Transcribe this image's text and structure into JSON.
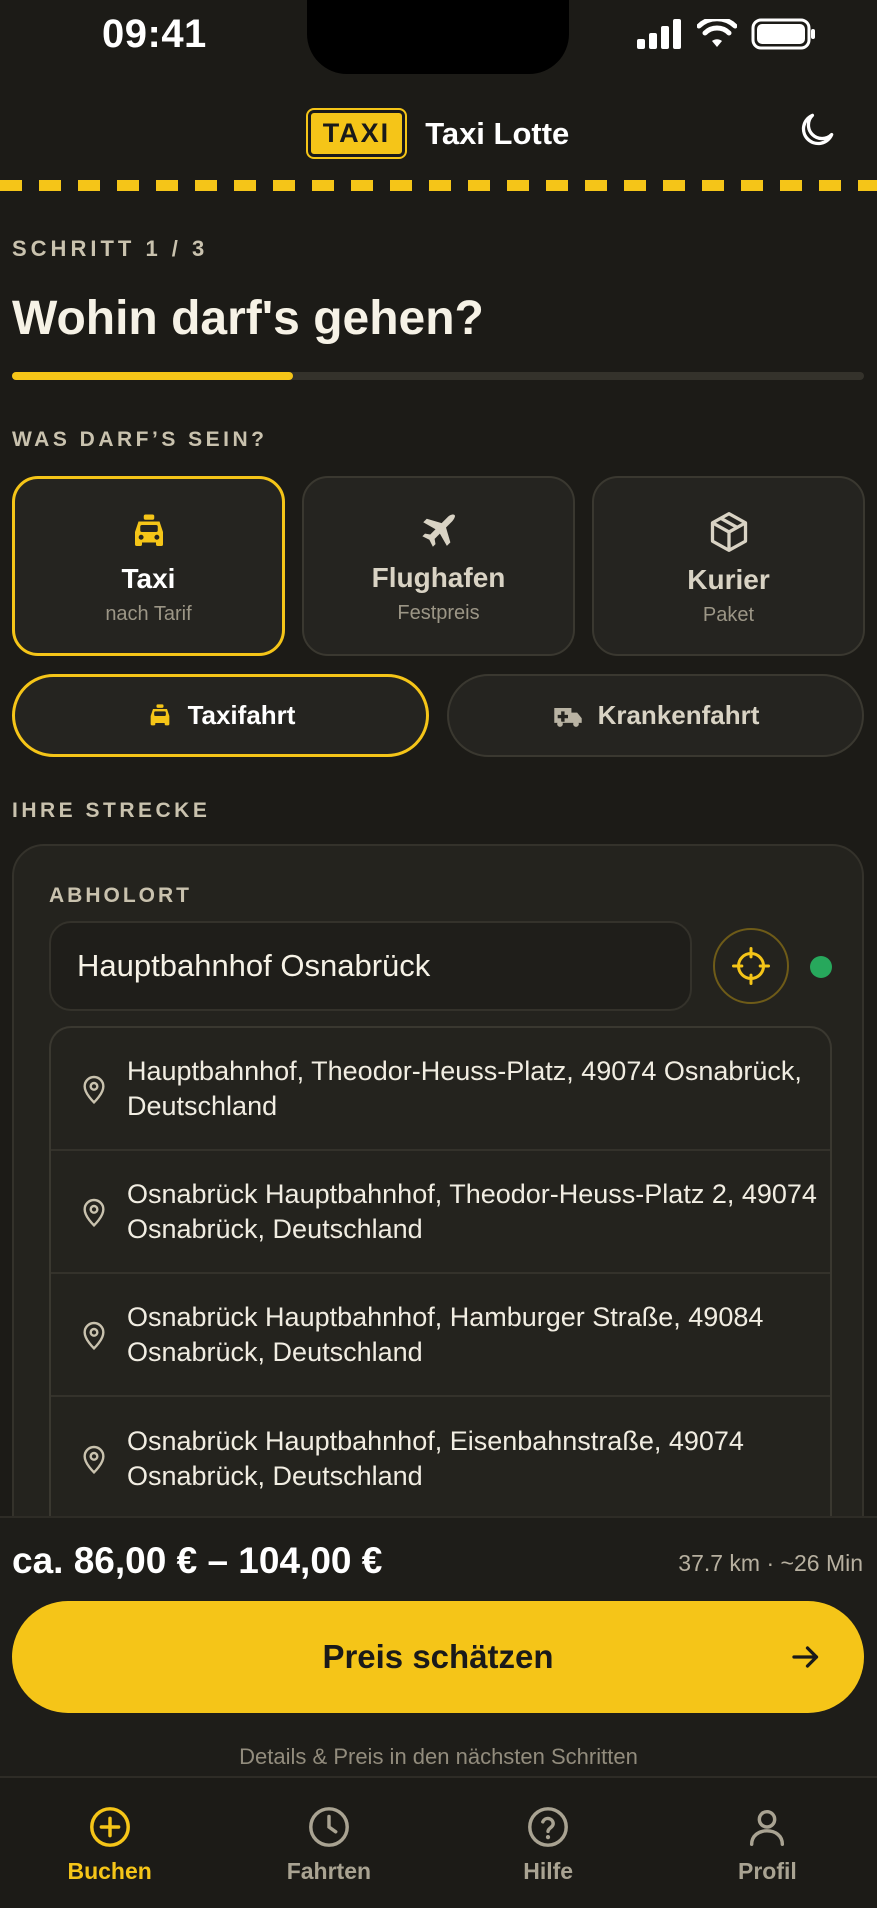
{
  "status_bar": {
    "time": "09:41"
  },
  "header": {
    "badge": "TAXI",
    "title": "Taxi Lotte",
    "theme_icon": "moon-icon"
  },
  "step": {
    "label": "SCHRITT 1 / 3",
    "progress": 0.33
  },
  "title": "Wohin darf's gehen?",
  "service_section": {
    "label": "WAS DARF’S SEIN?",
    "cards": [
      {
        "title": "Taxi",
        "subtitle": "nach Tarif",
        "icon": "taxi-icon",
        "selected": true
      },
      {
        "title": "Flughafen",
        "subtitle": "Festpreis",
        "icon": "plane-icon",
        "selected": false
      },
      {
        "title": "Kurier",
        "subtitle": "Paket",
        "icon": "package-icon",
        "selected": false
      }
    ]
  },
  "ride_type": {
    "options": [
      {
        "label": "Taxifahrt",
        "icon": "taxi-icon",
        "selected": true
      },
      {
        "label": "Krankenfahrt",
        "icon": "ambulance-icon",
        "selected": false
      }
    ]
  },
  "route": {
    "label": "IHRE STRECKE",
    "pickup_label": "ABHOLORT",
    "pickup_value": "Hauptbahnhof Osnabrück",
    "suggestions": [
      "Hauptbahnhof, Theodor-Heuss-Platz, 49074 Osnabrück, Deutschland",
      "Osnabrück Hauptbahnhof, Theodor-Heuss-Platz 2, 49074 Osnabrück, Deutschland",
      "Osnabrück Hauptbahnhof, Hamburger Straße, 49084 Osnabrück, Deutschland",
      "Osnabrück Hauptbahnhof, Eisenbahnstraße, 49074 Osnabrück, Deutschland"
    ]
  },
  "estimate": {
    "price": "ca. 86,00 € – 104,00 €",
    "meta": "37.7 km · ~26 Min",
    "cta": "Preis schätzen",
    "hint": "Details & Preis in den nächsten Schritten"
  },
  "tabs": [
    {
      "label": "Buchen",
      "icon": "plus-circle-icon",
      "active": true
    },
    {
      "label": "Fahrten",
      "icon": "clock-icon",
      "active": false
    },
    {
      "label": "Hilfe",
      "icon": "help-icon",
      "active": false
    },
    {
      "label": "Profil",
      "icon": "user-icon",
      "active": false
    }
  ],
  "colors": {
    "accent": "#f5c518",
    "background": "#1c1b17",
    "success": "#27a85c"
  }
}
